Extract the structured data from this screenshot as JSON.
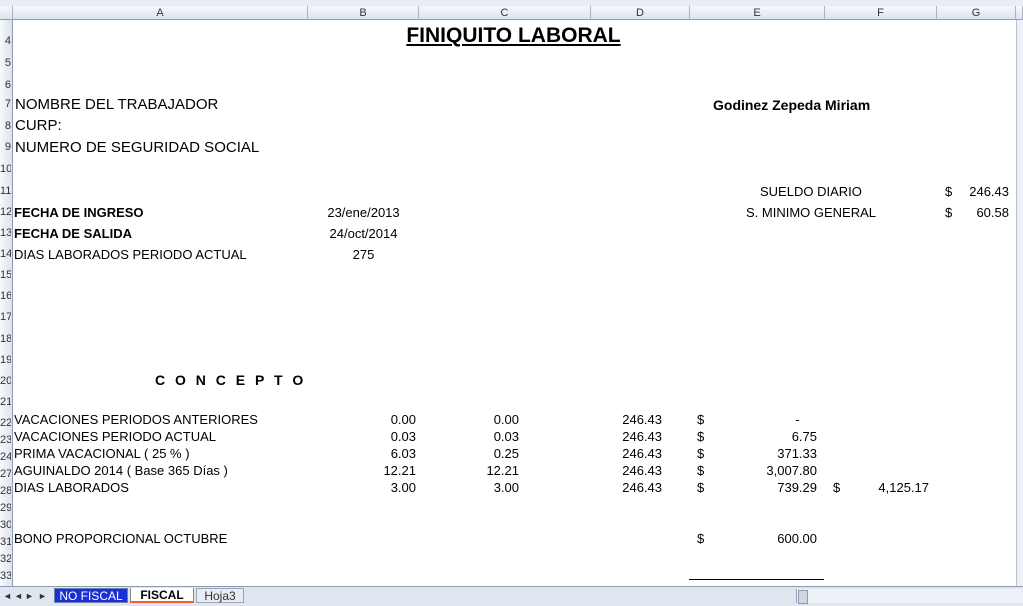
{
  "columns": [
    {
      "label": "A"
    },
    {
      "label": "B"
    },
    {
      "label": "C"
    },
    {
      "label": "D"
    },
    {
      "label": "E"
    },
    {
      "label": "F"
    },
    {
      "label": "G"
    }
  ],
  "rows": [
    "4",
    "5",
    "6",
    "7",
    "8",
    "9",
    "10",
    "11",
    "12",
    "13",
    "14",
    "15",
    "16",
    "17",
    "18",
    "19",
    "20",
    "21",
    "22",
    "23",
    "24",
    "27",
    "28",
    "29",
    "30",
    "31",
    "32",
    "33"
  ],
  "title": "FINIQUITO LABORAL",
  "worker": {
    "name_label": "NOMBRE DEL TRABAJADOR",
    "name_value": "Godinez Zepeda  Miriam",
    "curp_label": "CURP:",
    "nss_label": "NUMERO DE SEGURIDAD SOCIAL"
  },
  "salary": {
    "daily_label": "SUELDO DIARIO",
    "daily_currency": "$",
    "daily_value": "246.43",
    "min_label": "S. MINIMO GENERAL",
    "min_currency": "$",
    "min_value": "60.58"
  },
  "dates": {
    "ingreso_label": "FECHA DE INGRESO",
    "ingreso_value": "23/ene/2013",
    "salida_label": "FECHA DE SALIDA",
    "salida_value": "24/oct/2014",
    "dias_label": "DIAS LABORADOS PERIODO ACTUAL",
    "dias_value": "275"
  },
  "concepto_header": "C O N C E P T O",
  "concepts": [
    {
      "label": "VACACIONES PERIODOS ANTERIORES",
      "b": "0.00",
      "c": "0.00",
      "d": "246.43",
      "cur": "$",
      "amount": "-"
    },
    {
      "label": "VACACIONES PERIODO ACTUAL",
      "b": "0.03",
      "c": "0.03",
      "d": "246.43",
      "cur": "$",
      "amount": "6.75"
    },
    {
      "label": "PRIMA VACACIONAL ( 25 % )",
      "b": "6.03",
      "c": "0.25",
      "d": "246.43",
      "cur": "$",
      "amount": "371.33"
    },
    {
      "label": "AGUINALDO 2014 ( Base 365 Días )",
      "b": "12.21",
      "c": "12.21",
      "d": "246.43",
      "cur": "$",
      "amount": "3,007.80"
    },
    {
      "label": "DIAS LABORADOS",
      "b": "3.00",
      "c": "3.00",
      "d": "246.43",
      "cur": "$",
      "amount": "739.29"
    }
  ],
  "subtotal": {
    "currency": "$",
    "value": "4,125.17"
  },
  "bono": {
    "label": "BONO PROPORCIONAL OCTUBRE",
    "currency": "$",
    "value": "600.00"
  },
  "tabs": [
    {
      "label": "NO FISCAL"
    },
    {
      "label": "FISCAL"
    },
    {
      "label": "Hoja3"
    }
  ],
  "nav": {
    "first": "◄",
    "prev": "◄",
    "next": "►",
    "last": "►"
  }
}
